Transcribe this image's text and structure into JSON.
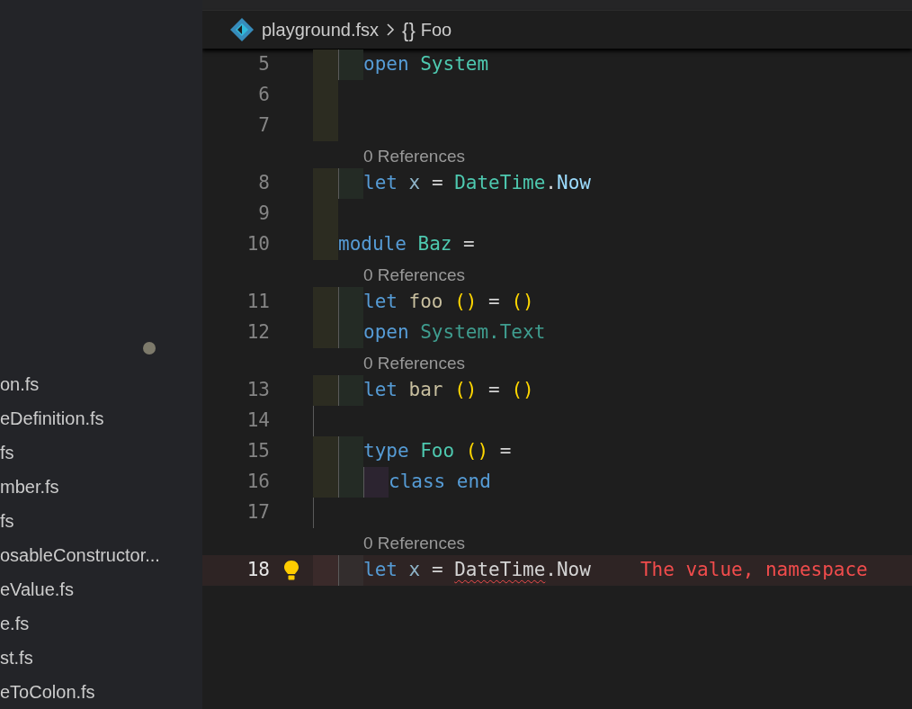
{
  "sidebar": {
    "files": [
      "on.fs",
      "eDefinition.fs",
      "fs",
      "mber.fs",
      "fs",
      "osableConstructor...",
      "eValue.fs",
      "e.fs",
      "st.fs",
      "eToColon.fs"
    ]
  },
  "breadcrumb": {
    "file": "playground.fsx",
    "symbol_glyph": "{}",
    "symbol": "Foo"
  },
  "editor": {
    "lines": [
      {
        "kind": "code",
        "number": "5",
        "guides": [
          {
            "kind": "outer"
          },
          {
            "kind": "inner"
          }
        ],
        "tokens": [
          {
            "text": "open ",
            "kind": "keyword"
          },
          {
            "text": "System",
            "kind": "type"
          }
        ]
      },
      {
        "kind": "code",
        "number": "6",
        "guides": [
          {
            "kind": "outer"
          }
        ]
      },
      {
        "kind": "code",
        "number": "7",
        "guides": [
          {
            "kind": "outer"
          }
        ]
      },
      {
        "kind": "lens",
        "text": "0 References"
      },
      {
        "kind": "code",
        "number": "8",
        "guides": [
          {
            "kind": "outer"
          },
          {
            "kind": "inner"
          }
        ],
        "tokens": [
          {
            "text": "let ",
            "kind": "keyword"
          },
          {
            "text": "x ",
            "kind": "ident"
          },
          {
            "text": "= ",
            "kind": "op"
          },
          {
            "text": "DateTime",
            "kind": "type"
          },
          {
            "text": ".",
            "kind": "op"
          },
          {
            "text": "Now",
            "kind": "member"
          }
        ]
      },
      {
        "kind": "code",
        "number": "9",
        "guides": [
          {
            "kind": "outer"
          }
        ]
      },
      {
        "kind": "code",
        "number": "10",
        "guides": [
          {
            "kind": "outer"
          }
        ],
        "tokens": [
          {
            "text": "module ",
            "kind": "keyword"
          },
          {
            "text": "Baz ",
            "kind": "type"
          },
          {
            "text": "=",
            "kind": "op"
          }
        ]
      },
      {
        "kind": "lens",
        "text": "0 References"
      },
      {
        "kind": "code",
        "number": "11",
        "guides": [
          {
            "kind": "outer"
          },
          {
            "kind": "inner"
          }
        ],
        "tokens": [
          {
            "text": "let ",
            "kind": "keyword"
          },
          {
            "text": "foo ",
            "kind": "func"
          },
          {
            "text": "() ",
            "kind": "paren"
          },
          {
            "text": "= ",
            "kind": "op"
          },
          {
            "text": "()",
            "kind": "paren"
          }
        ]
      },
      {
        "kind": "code",
        "number": "12",
        "guides": [
          {
            "kind": "outer"
          },
          {
            "kind": "inner"
          }
        ],
        "tokens": [
          {
            "text": "open ",
            "kind": "keyword"
          },
          {
            "text": "System.Text",
            "kind": "faded"
          }
        ]
      },
      {
        "kind": "lens",
        "text": "0 References"
      },
      {
        "kind": "code",
        "number": "13",
        "guides": [
          {
            "kind": "outer"
          },
          {
            "kind": "inner"
          }
        ],
        "tokens": [
          {
            "text": "let ",
            "kind": "keyword"
          },
          {
            "text": "bar ",
            "kind": "func"
          },
          {
            "text": "() ",
            "kind": "paren"
          },
          {
            "text": "= ",
            "kind": "op"
          },
          {
            "text": "()",
            "kind": "paren"
          }
        ]
      },
      {
        "kind": "code",
        "number": "14",
        "guides": [
          {
            "kind": "line"
          }
        ]
      },
      {
        "kind": "code",
        "number": "15",
        "guides": [
          {
            "kind": "outer"
          },
          {
            "kind": "inner"
          }
        ],
        "tokens": [
          {
            "text": "type ",
            "kind": "keyword"
          },
          {
            "text": "Foo ",
            "kind": "type"
          },
          {
            "text": "() ",
            "kind": "paren"
          },
          {
            "text": "=",
            "kind": "op"
          }
        ]
      },
      {
        "kind": "code",
        "number": "16",
        "guides": [
          {
            "kind": "outer"
          },
          {
            "kind": "inner"
          },
          {
            "kind": "nested"
          }
        ],
        "tokens": [
          {
            "text": "class ",
            "kind": "keyword"
          },
          {
            "text": "end",
            "kind": "keyword"
          }
        ]
      },
      {
        "kind": "code",
        "number": "17",
        "guides": [
          {
            "kind": "line"
          }
        ]
      },
      {
        "kind": "lens",
        "text": "0 References"
      },
      {
        "kind": "code",
        "number": "18",
        "current": true,
        "bulb": true,
        "guides": [
          {
            "kind": "error"
          },
          {
            "kind": "current"
          }
        ],
        "tokens": [
          {
            "text": "let ",
            "kind": "keyword"
          },
          {
            "text": "x ",
            "kind": "ident"
          },
          {
            "text": "= ",
            "kind": "op"
          },
          {
            "text": "DateTime",
            "kind": "error"
          },
          {
            "text": ".Now",
            "kind": "op"
          }
        ],
        "diagnostic": "The value, namespace"
      }
    ]
  }
}
